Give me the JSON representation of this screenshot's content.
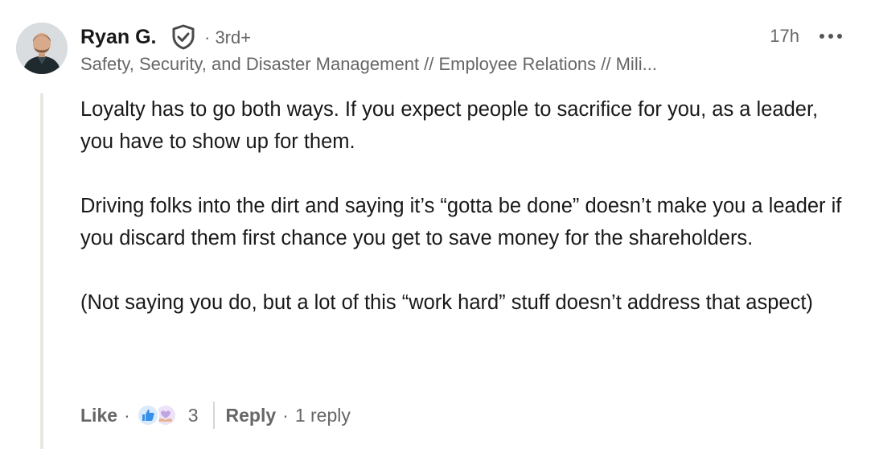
{
  "comment": {
    "author": {
      "name": "Ryan G.",
      "degree": "· 3rd+",
      "headline": "Safety, Security, and Disaster Management // Employee Relations // Mili..."
    },
    "time": "17h",
    "paragraphs": [
      "Loyalty has to go both ways. If you expect people to sacrifice for you, as a leader, you have to show up for them.",
      "Driving folks into the dirt and saying it’s “gotta be done” doesn’t make you a leader if you discard them first chance you get to save money for the shareholders.",
      "(Not saying you do, but a lot of this “work hard” stuff doesn’t address that aspect)"
    ],
    "actions": {
      "like_label": "Like",
      "reaction_count": "3",
      "reply_label": "Reply",
      "replies_label": "1 reply"
    }
  },
  "icons": {
    "verified": "shield-check-icon",
    "more": "more-horizontal-icon",
    "reactions": [
      "like-reaction-icon",
      "support-reaction-icon"
    ]
  },
  "colors": {
    "text_primary": "#000000e6",
    "text_secondary": "#666666",
    "like_blue": "#378fe9",
    "support_purple": "#c0a4e3",
    "thread_line": "#e8e6e1"
  }
}
